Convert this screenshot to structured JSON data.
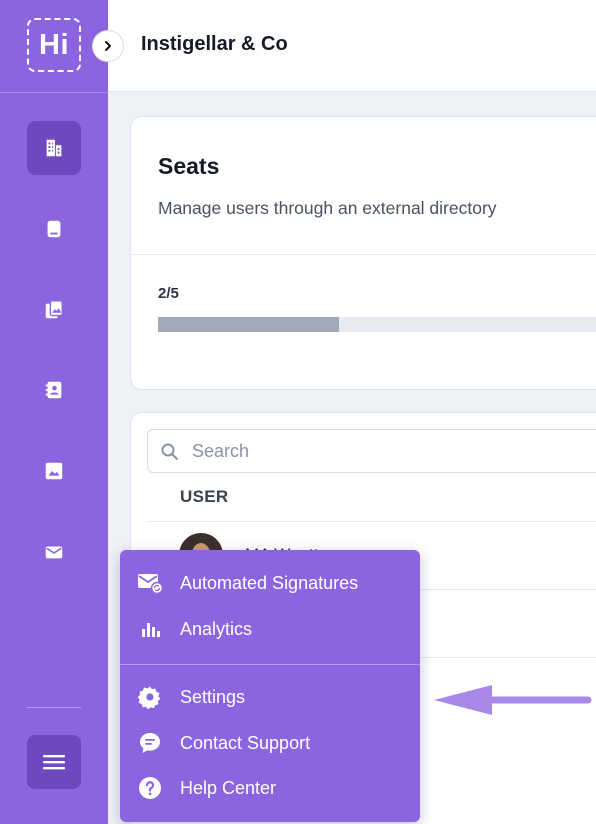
{
  "brand": {
    "logo_text": "Hi"
  },
  "header": {
    "title": "Instigellar & Co"
  },
  "sidebar": {
    "items": [
      {
        "name": "company",
        "icon": "building-icon",
        "active": true
      },
      {
        "name": "signatures",
        "icon": "tablet-icon",
        "active": false
      },
      {
        "name": "templates",
        "icon": "gallery-icon",
        "active": false
      },
      {
        "name": "contacts",
        "icon": "contact-book-icon",
        "active": false
      },
      {
        "name": "images",
        "icon": "image-icon",
        "active": false
      },
      {
        "name": "mail",
        "icon": "envelope-icon",
        "active": false
      }
    ],
    "menu_icon": "hamburger-icon"
  },
  "seats": {
    "title": "Seats",
    "subtitle": "Manage users through an external directory",
    "count": "2/5",
    "progress": 0.4
  },
  "users": {
    "search_placeholder": "Search",
    "column_user": "USER",
    "rows": [
      {
        "name": "MA Wootton"
      }
    ]
  },
  "popup_menu": {
    "items": [
      {
        "label": "Automated Signatures",
        "icon": "mail-sync-icon"
      },
      {
        "label": "Analytics",
        "icon": "bar-chart-icon"
      },
      {
        "label": "Settings",
        "icon": "gear-icon"
      },
      {
        "label": "Contact Support",
        "icon": "chat-bubble-icon"
      },
      {
        "label": "Help Center",
        "icon": "help-circle-icon"
      }
    ]
  },
  "colors": {
    "sidebar": "#8b65e0",
    "active": "#6d48c1",
    "arrow": "#a888e8"
  }
}
